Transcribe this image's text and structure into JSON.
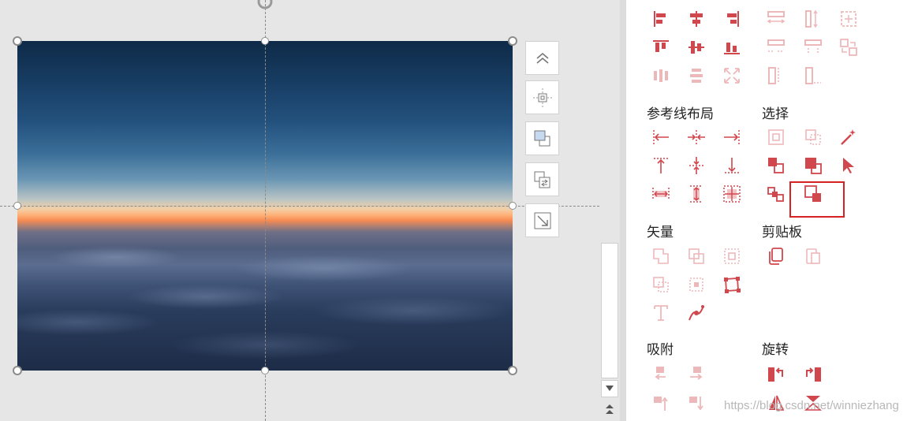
{
  "canvas": {
    "image_description_alt": "",
    "side_buttons": [
      "chevrons-up-icon",
      "align-center-target-icon",
      "bring-forward-layer-icon",
      "swap-images-icon",
      "resize-arrow-icon"
    ]
  },
  "panel": {
    "sections": {
      "guide_layout": "参考线布局",
      "select": "选择",
      "vector": "矢量",
      "clipboard": "剪贴板",
      "snap": "吸附",
      "rotate": "旋转"
    },
    "accent_color": "#d0474d",
    "faded_color": "#ecb3b5"
  },
  "watermark": "https://blog.csdn.net/winniezhang"
}
